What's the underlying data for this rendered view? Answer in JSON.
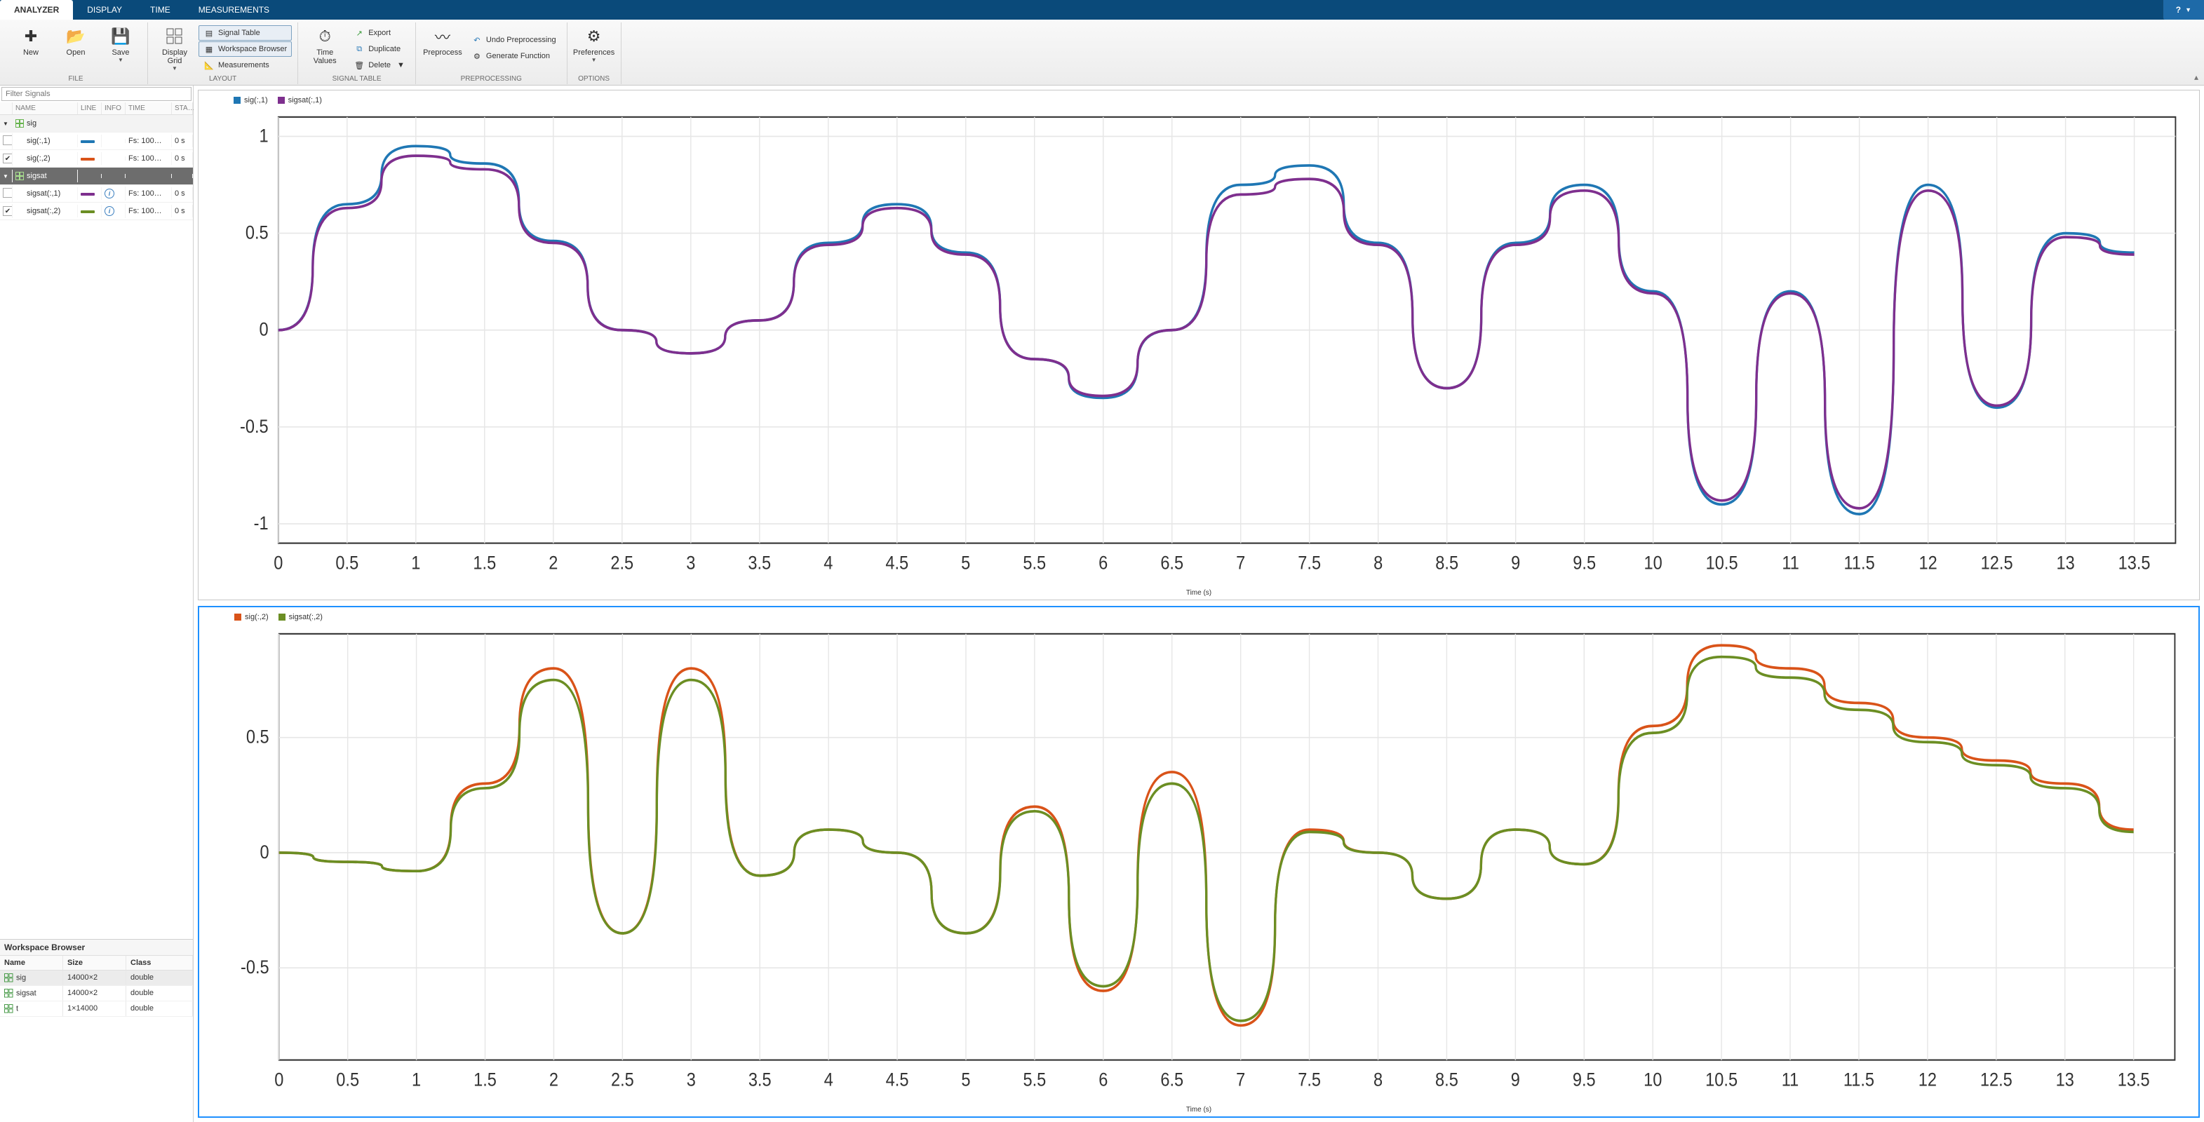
{
  "tabs": {
    "analyzer": "ANALYZER",
    "display": "DISPLAY",
    "time": "TIME",
    "measurements": "MEASUREMENTS"
  },
  "ribbon": {
    "file": {
      "label": "FILE",
      "new": "New",
      "open": "Open",
      "save": "Save"
    },
    "layout": {
      "label": "LAYOUT",
      "displayGrid": "Display Grid",
      "signalTable": "Signal Table",
      "workspaceBrowser": "Workspace Browser",
      "measurements": "Measurements"
    },
    "signalTable": {
      "label": "SIGNAL TABLE",
      "timeValues": "Time Values",
      "export": "Export",
      "duplicate": "Duplicate",
      "delete": "Delete"
    },
    "preprocessing": {
      "label": "PREPROCESSING",
      "preprocess": "Preprocess",
      "undo": "Undo Preprocessing",
      "generate": "Generate Function"
    },
    "options": {
      "label": "OPTIONS",
      "preferences": "Preferences"
    }
  },
  "filter": {
    "placeholder": "Filter Signals"
  },
  "sigHeaders": {
    "name": "NAME",
    "line": "LINE",
    "info": "INFO",
    "time": "TIME",
    "star": "STA…"
  },
  "signals": [
    {
      "kind": "group",
      "name": "sig",
      "sel": false
    },
    {
      "kind": "sig",
      "checked": false,
      "name": "sig(:,1)",
      "color": "#1f77b4",
      "info": false,
      "time": "Fs: 100…",
      "start": "0 s"
    },
    {
      "kind": "sig",
      "checked": true,
      "name": "sig(:,2)",
      "color": "#d95319",
      "info": false,
      "time": "Fs: 100…",
      "start": "0 s"
    },
    {
      "kind": "group",
      "name": "sigsat",
      "sel": true
    },
    {
      "kind": "sig",
      "checked": false,
      "name": "sigsat(:,1)",
      "color": "#7e2f8e",
      "info": true,
      "time": "Fs: 100…",
      "start": "0 s"
    },
    {
      "kind": "sig",
      "checked": true,
      "name": "sigsat(:,2)",
      "color": "#6b8e23",
      "info": true,
      "time": "Fs: 100…",
      "start": "0 s"
    }
  ],
  "workspace": {
    "title": "Workspace Browser",
    "headers": {
      "name": "Name",
      "size": "Size",
      "class": "Class"
    },
    "vars": [
      {
        "name": "sig",
        "size": "14000×2",
        "class": "double",
        "sel": true
      },
      {
        "name": "sigsat",
        "size": "14000×2",
        "class": "double",
        "sel": false
      },
      {
        "name": "t",
        "size": "1×14000",
        "class": "double",
        "sel": false
      }
    ]
  },
  "plots": {
    "xlabel": "Time (s)",
    "top": {
      "legend": [
        {
          "label": "sig(:,1)",
          "color": "#1f77b4"
        },
        {
          "label": "sigsat(:,1)",
          "color": "#7e2f8e"
        }
      ],
      "yticks": [
        -1.0,
        -0.5,
        0,
        0.5,
        1.0
      ],
      "xticks": [
        0,
        0.5,
        1.0,
        1.5,
        2.0,
        2.5,
        3.0,
        3.5,
        4.0,
        4.5,
        5.0,
        5.5,
        6.0,
        6.5,
        7.0,
        7.5,
        8.0,
        8.5,
        9.0,
        9.5,
        10.0,
        10.5,
        11.0,
        11.5,
        12.0,
        12.5,
        13.0,
        13.5
      ]
    },
    "bottom": {
      "legend": [
        {
          "label": "sig(:,2)",
          "color": "#d95319"
        },
        {
          "label": "sigsat(:,2)",
          "color": "#6b8e23"
        }
      ],
      "yticks": [
        -0.5,
        0,
        0.5
      ],
      "xticks": [
        0,
        0.5,
        1.0,
        1.5,
        2.0,
        2.5,
        3.0,
        3.5,
        4.0,
        4.5,
        5.0,
        5.5,
        6.0,
        6.5,
        7.0,
        7.5,
        8.0,
        8.5,
        9.0,
        9.5,
        10.0,
        10.5,
        11.0,
        11.5,
        12.0,
        12.5,
        13.0,
        13.5
      ]
    }
  },
  "chart_data": [
    {
      "type": "line",
      "title": "",
      "xlabel": "Time (s)",
      "ylabel": "",
      "xlim": [
        0,
        13.8
      ],
      "ylim": [
        -1.1,
        1.1
      ],
      "series": [
        {
          "name": "sig(:,1)",
          "color": "#1f77b4",
          "x": [
            0,
            0.5,
            1.0,
            1.5,
            2.0,
            2.5,
            3.0,
            3.5,
            4.0,
            4.5,
            5.0,
            5.5,
            6.0,
            6.5,
            7.0,
            7.5,
            8.0,
            8.5,
            9.0,
            9.5,
            10.0,
            10.5,
            11.0,
            11.5,
            12.0,
            12.5,
            13.0,
            13.5
          ],
          "y": [
            0.0,
            0.65,
            0.95,
            0.86,
            0.46,
            0.0,
            -0.12,
            0.05,
            0.45,
            0.65,
            0.4,
            -0.15,
            -0.35,
            0.0,
            0.75,
            0.85,
            0.45,
            -0.3,
            0.45,
            0.75,
            0.2,
            -0.9,
            0.2,
            -0.95,
            0.75,
            -0.4,
            0.5,
            0.4
          ]
        },
        {
          "name": "sigsat(:,1)",
          "color": "#7e2f8e",
          "x": [
            0,
            0.5,
            1.0,
            1.5,
            2.0,
            2.5,
            3.0,
            3.5,
            4.0,
            4.5,
            5.0,
            5.5,
            6.0,
            6.5,
            7.0,
            7.5,
            8.0,
            8.5,
            9.0,
            9.5,
            10.0,
            10.5,
            11.0,
            11.5,
            12.0,
            12.5,
            13.0,
            13.5
          ],
          "y": [
            0.0,
            0.63,
            0.9,
            0.83,
            0.45,
            0.0,
            -0.12,
            0.05,
            0.44,
            0.63,
            0.39,
            -0.15,
            -0.34,
            0.0,
            0.7,
            0.78,
            0.44,
            -0.3,
            0.44,
            0.72,
            0.19,
            -0.88,
            0.19,
            -0.92,
            0.72,
            -0.39,
            0.48,
            0.39
          ]
        }
      ]
    },
    {
      "type": "line",
      "title": "",
      "xlabel": "Time (s)",
      "ylabel": "",
      "xlim": [
        0,
        13.8
      ],
      "ylim": [
        -0.9,
        0.95
      ],
      "series": [
        {
          "name": "sig(:,2)",
          "color": "#d95319",
          "x": [
            0,
            0.5,
            1.0,
            1.5,
            2.0,
            2.5,
            3.0,
            3.5,
            4.0,
            4.5,
            5.0,
            5.5,
            6.0,
            6.5,
            7.0,
            7.5,
            8.0,
            8.5,
            9.0,
            9.5,
            10.0,
            10.5,
            11.0,
            11.5,
            12.0,
            12.5,
            13.0,
            13.5
          ],
          "y": [
            0.0,
            -0.04,
            -0.08,
            0.3,
            0.8,
            -0.35,
            0.8,
            -0.1,
            0.1,
            0.0,
            -0.35,
            0.2,
            -0.6,
            0.35,
            -0.75,
            0.1,
            0.0,
            -0.2,
            0.1,
            -0.05,
            0.55,
            0.9,
            0.8,
            0.65,
            0.5,
            0.4,
            0.3,
            0.1
          ]
        },
        {
          "name": "sigsat(:,2)",
          "color": "#6b8e23",
          "x": [
            0,
            0.5,
            1.0,
            1.5,
            2.0,
            2.5,
            3.0,
            3.5,
            4.0,
            4.5,
            5.0,
            5.5,
            6.0,
            6.5,
            7.0,
            7.5,
            8.0,
            8.5,
            9.0,
            9.5,
            10.0,
            10.5,
            11.0,
            11.5,
            12.0,
            12.5,
            13.0,
            13.5
          ],
          "y": [
            0.0,
            -0.04,
            -0.08,
            0.28,
            0.75,
            -0.35,
            0.75,
            -0.1,
            0.1,
            0.0,
            -0.35,
            0.18,
            -0.58,
            0.3,
            -0.73,
            0.09,
            0.0,
            -0.2,
            0.1,
            -0.05,
            0.52,
            0.85,
            0.76,
            0.62,
            0.48,
            0.38,
            0.28,
            0.09
          ]
        }
      ]
    }
  ]
}
